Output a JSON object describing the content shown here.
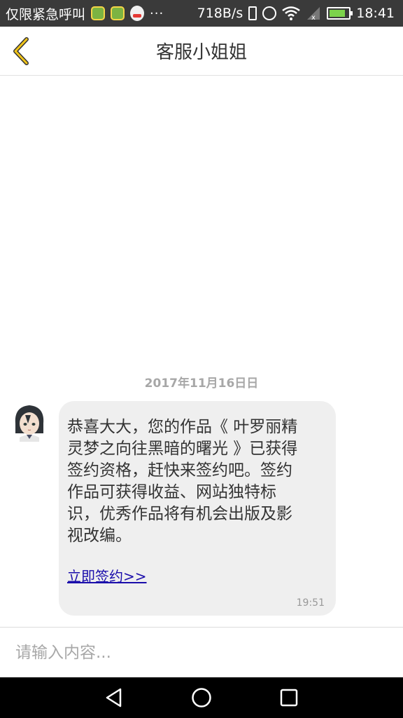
{
  "status_bar": {
    "carrier_text": "仅限紧急呼叫",
    "more": "···",
    "net_speed": "718B/s",
    "time": "18:41",
    "icons": [
      "wechat-money-icon",
      "wechat-money-icon",
      "qq-icon",
      "vibrate-icon",
      "alarm-icon",
      "wifi-icon",
      "signal-icon",
      "battery-charging-icon"
    ]
  },
  "header": {
    "title": "客服小姐姐",
    "back_icon": "chevron-left-icon",
    "accent_color": "#f0c419"
  },
  "chat": {
    "date": "2017年11月16日日",
    "messages": [
      {
        "sender_avatar": "avatar",
        "text": " 恭喜大大，您的作品《 叶罗丽精灵梦之向往黑暗的曙光 》已获得签约资格，赶快来签约吧。签约作品可获得收益、网站独特标识，优秀作品将有机会出版及影视改编。",
        "link_text": "立即签约>> ",
        "time": "19:51"
      }
    ]
  },
  "input": {
    "placeholder": "请输入内容..."
  },
  "nav_bar": {
    "buttons": [
      "back-triangle-icon",
      "home-circle-icon",
      "recents-square-icon"
    ]
  }
}
